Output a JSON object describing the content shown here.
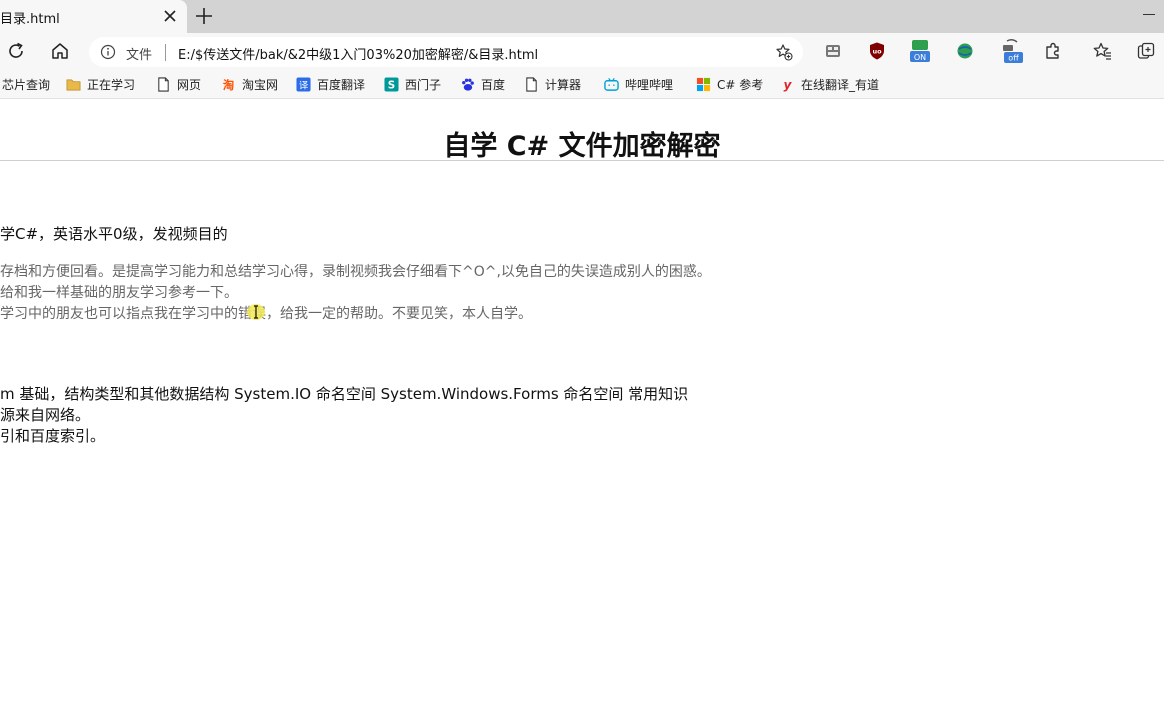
{
  "browser": {
    "tab_title": "目录.html",
    "address": {
      "scheme_label": "文件",
      "url": "E:/$传送文件/bak/&2中级1入门03%20加密解密/&目录.html"
    },
    "extension_badges": {
      "on": "ON",
      "off": "off"
    },
    "favorites": [
      {
        "label": "芯片查询",
        "icon": "globe-icon"
      },
      {
        "label": "正在学习",
        "icon": "folder-icon"
      },
      {
        "label": "网页",
        "icon": "page-icon"
      },
      {
        "label": "淘宝网",
        "icon": "taobao-icon"
      },
      {
        "label": "百度翻译",
        "icon": "translate-icon"
      },
      {
        "label": "西门子",
        "icon": "siemens-icon"
      },
      {
        "label": "百度",
        "icon": "baidu-icon"
      },
      {
        "label": "计算器",
        "icon": "page-icon"
      },
      {
        "label": "哔哩哔哩",
        "icon": "bilibili-icon"
      },
      {
        "label": "C# 参考",
        "icon": "microsoft-icon"
      },
      {
        "label": "在线翻译_有道",
        "icon": "youdao-icon"
      }
    ]
  },
  "page": {
    "title": "自学 C# 文件加密解密",
    "lines": [
      "学C#，英语水平0级，发视频目的",
      "存档和方便回看。是提高学习能力和总结学习心得，录制视频我会仔细看下^O^,以免自己的失误造成别人的困惑。",
      "给和我一样基础的朋友学习参考一下。",
      "学习中的朋友也可以指点我在学习中的错误，给我一定的帮助。不要见笑，本人自学。",
      "m 基础，结构类型和其他数据结构   System.IO 命名空间  System.Windows.Forms 命名空间 常用知识",
      "源来自网络。",
      "引和百度索引。"
    ]
  },
  "colors": {
    "tab_strip": "#d3d3d3",
    "toolbar": "#f7f7f7",
    "text": "#111111",
    "muted_text": "#666666",
    "ublock_red": "#800000",
    "ext_green": "#2e9e4f",
    "ext_blue": "#3b7dd8"
  }
}
